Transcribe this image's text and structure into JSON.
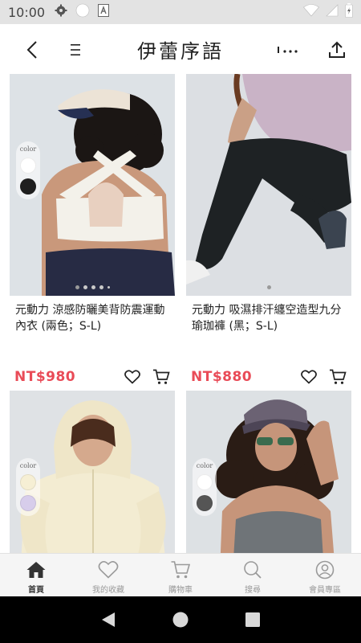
{
  "status_bar": {
    "time": "10:00",
    "icons": [
      "gear-icon",
      "circle-icon",
      "a-box-icon",
      "wifi-icon",
      "battery-icon"
    ]
  },
  "header": {
    "title": "伊蕾序語",
    "icons": [
      "back-icon",
      "menu-icon",
      "more-icon",
      "share-icon"
    ]
  },
  "products": [
    {
      "name": "元動力 涼感防曬美背防震運動內衣 (兩色；S-L)",
      "price": "NT$980",
      "swatch_label": "color",
      "swatches": [
        "#ffffff",
        "#1f1f1f"
      ],
      "image_dots": 5
    },
    {
      "name": "元動力 吸濕排汗纏空造型九分瑜珈褲 (黑；S-L)",
      "price": "NT$880",
      "image_dots": 1
    },
    {
      "name": "",
      "price": "",
      "swatch_label": "color",
      "swatches": [
        "#f6efd4",
        "#d7cdeb"
      ]
    },
    {
      "name": "",
      "price": "",
      "swatch_label": "color",
      "swatches": [
        "#ffffff",
        "#555555"
      ]
    }
  ],
  "bottom_nav": {
    "items": [
      {
        "label": "首頁",
        "icon": "home-icon",
        "active": true
      },
      {
        "label": "我的收藏",
        "icon": "heart-icon",
        "active": false
      },
      {
        "label": "購物車",
        "icon": "cart-icon",
        "active": false
      },
      {
        "label": "搜尋",
        "icon": "search-icon",
        "active": false
      },
      {
        "label": "會員專區",
        "icon": "user-icon",
        "active": false
      }
    ]
  },
  "colors": {
    "price": "#e94b57",
    "status_bar_bg": "#e3e3e3",
    "nav_bg": "#f5f5f5",
    "text": "#222222"
  }
}
